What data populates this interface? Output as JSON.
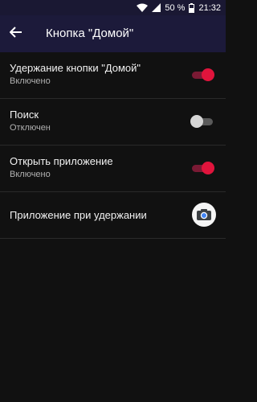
{
  "statusbar": {
    "battery_percent": "50 %",
    "time": "21:32"
  },
  "appbar": {
    "title": "Кнопка \"Домой\""
  },
  "settings": [
    {
      "title": "Удержание кнопки \"Домой\"",
      "subtitle": "Включено",
      "control": "toggle",
      "checked": true
    },
    {
      "title": "Поиск",
      "subtitle": "Отключен",
      "control": "toggle",
      "checked": false
    },
    {
      "title": "Открыть приложение",
      "subtitle": "Включено",
      "control": "toggle",
      "checked": true
    },
    {
      "title": "Приложение при удержании",
      "control": "app-icon",
      "icon": "camera-app-icon"
    }
  ],
  "colors": {
    "appbar": "#1c1a3a",
    "background": "#111111",
    "accent": "#e0143c"
  }
}
